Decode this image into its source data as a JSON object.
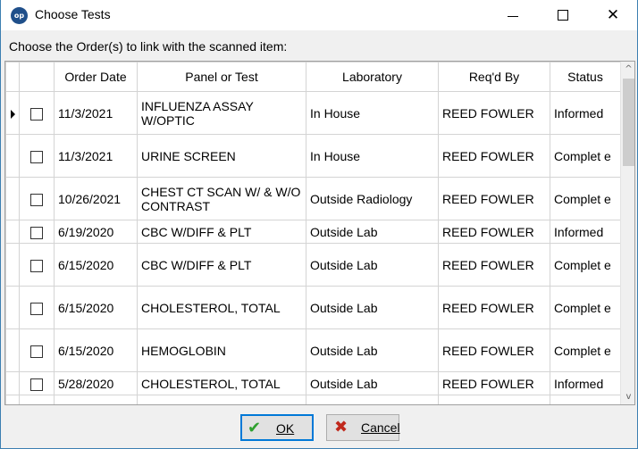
{
  "window": {
    "title": "Choose Tests",
    "icon_text": "op",
    "minimize_glyph": "—",
    "maximize_glyph": "☐",
    "close_glyph": "✕"
  },
  "instruction": "Choose the Order(s) to link with the scanned item:",
  "table": {
    "columns": [
      "Order Date",
      "Panel or Test",
      "Laboratory",
      "Req'd By",
      "Status"
    ],
    "rows": [
      {
        "date": "11/3/2021",
        "panel": "INFLUENZA ASSAY W/OPTIC",
        "lab": "In House",
        "req": "REED FOWLER",
        "status": "Informed",
        "current": true
      },
      {
        "date": "11/3/2021",
        "panel": "URINE SCREEN",
        "lab": "In House",
        "req": "REED FOWLER",
        "status": "Complet e"
      },
      {
        "date": "10/26/2021",
        "panel": "CHEST CT SCAN W/ & W/O CONTRAST",
        "lab": "Outside Radiology",
        "req": "REED FOWLER",
        "status": "Complet e"
      },
      {
        "date": "6/19/2020",
        "panel": "CBC W/DIFF & PLT",
        "lab": "Outside Lab",
        "req": "REED FOWLER",
        "status": "Informed"
      },
      {
        "date": "6/15/2020",
        "panel": "CBC W/DIFF & PLT",
        "lab": "Outside Lab",
        "req": "REED FOWLER",
        "status": "Complet e"
      },
      {
        "date": "6/15/2020",
        "panel": "CHOLESTEROL, TOTAL",
        "lab": "Outside Lab",
        "req": "REED FOWLER",
        "status": "Complet e"
      },
      {
        "date": "6/15/2020",
        "panel": "HEMOGLOBIN",
        "lab": "Outside Lab",
        "req": "REED FOWLER",
        "status": "Complet e"
      },
      {
        "date": "5/28/2020",
        "panel": "CHOLESTEROL, TOTAL",
        "lab": "Outside Lab",
        "req": "REED FOWLER",
        "status": "Informed"
      }
    ]
  },
  "scrollbar": {
    "up_glyph": "^",
    "down_glyph": "v"
  },
  "buttons": {
    "ok_label": "OK",
    "ok_icon": "✔",
    "cancel_label": "Cancel",
    "cancel_icon": "✖"
  },
  "colors": {
    "accent": "#0078d7",
    "ok_icon": "#2ea02e",
    "cancel_icon": "#c0281c"
  }
}
